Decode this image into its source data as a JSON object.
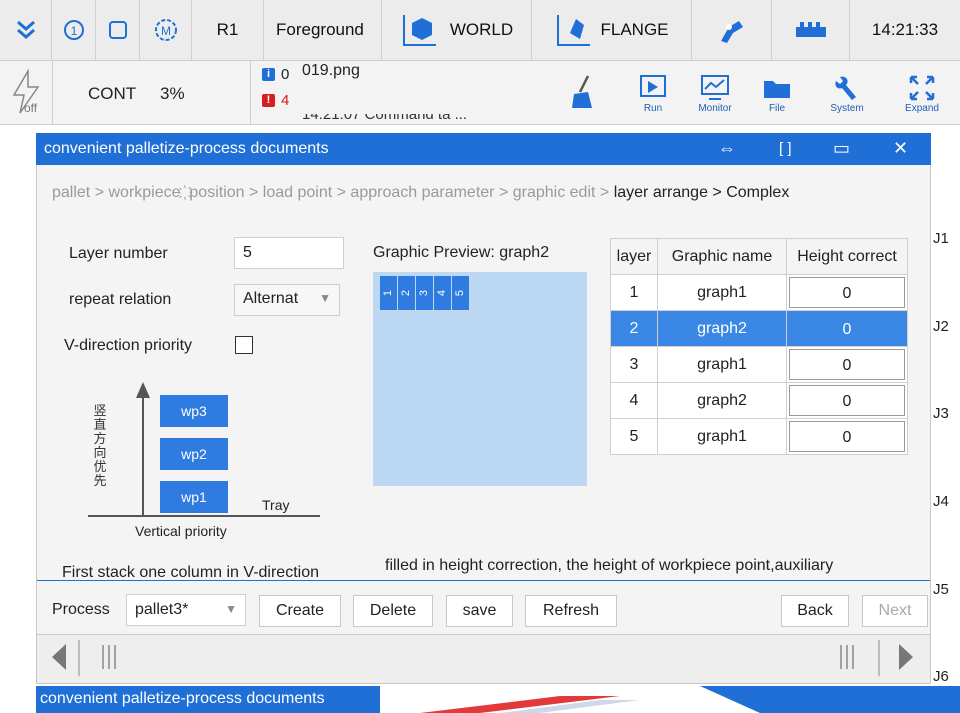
{
  "topbar": {
    "robot": "R1",
    "mode": "Foreground",
    "coord_frame": "WORLD",
    "tool_frame": "FLANGE",
    "time": "14:21:33"
  },
  "secbar": {
    "run_mode": "CONT",
    "speed": "3%",
    "power_label": "off",
    "info_count": "0",
    "error_count": "4",
    "file_name": "019.png",
    "log_partial": "14:21:07 Command  ta ...",
    "buttons": [
      "Run",
      "Monitor",
      "File",
      "System",
      "Expand"
    ]
  },
  "dialog": {
    "title": "convenient palletize-process documents",
    "breadcrumb_dim": "pallet > workpiece ҉ position > load point > approach parameter > graphic edit > ",
    "breadcrumb_current": "layer arrange > Complex",
    "layer_number_label": "Layer number",
    "layer_number_value": "5",
    "repeat_relation_label": "repeat relation",
    "repeat_relation_value": "Alternat",
    "v_priority_label": "V-direction priority",
    "preview_title": "Graphic Preview: graph2",
    "preview_cells": [
      "1",
      "2",
      "3",
      "4",
      "5"
    ],
    "diagram": {
      "y_label": [
        "竖",
        "直",
        "方",
        "向",
        "优",
        "先"
      ],
      "stack": [
        "wp3",
        "wp2",
        "wp1"
      ],
      "tray": "Tray",
      "caption": "Vertical priority"
    },
    "table": {
      "headers": [
        "layer",
        "Graphic name",
        "Height correct"
      ],
      "rows": [
        {
          "layer": "1",
          "graphic": "graph1",
          "height": "0"
        },
        {
          "layer": "2",
          "graphic": "graph2",
          "height": "0"
        },
        {
          "layer": "3",
          "graphic": "graph1",
          "height": "0"
        },
        {
          "layer": "4",
          "graphic": "graph2",
          "height": "0"
        },
        {
          "layer": "5",
          "graphic": "graph1",
          "height": "0"
        }
      ]
    },
    "note_left": "First stack one column in V-direction",
    "note_right": "filled in height correction, the height of workpiece point,auxiliary",
    "process_label": "Process",
    "process_value": "pallet3*",
    "buttons": {
      "create": "Create",
      "delete": "Delete",
      "save": "save",
      "refresh": "Refresh",
      "back": "Back",
      "next": "Next"
    }
  },
  "joints": [
    "J1",
    "J2",
    "J3",
    "J4",
    "J5",
    "J6"
  ],
  "taskbar": {
    "item": "convenient palletize-process documents"
  },
  "colors": {
    "accent": "#1f6fd6",
    "selection": "#3a87e6",
    "preview_bg": "#bcd8f2",
    "error": "#d62020"
  }
}
